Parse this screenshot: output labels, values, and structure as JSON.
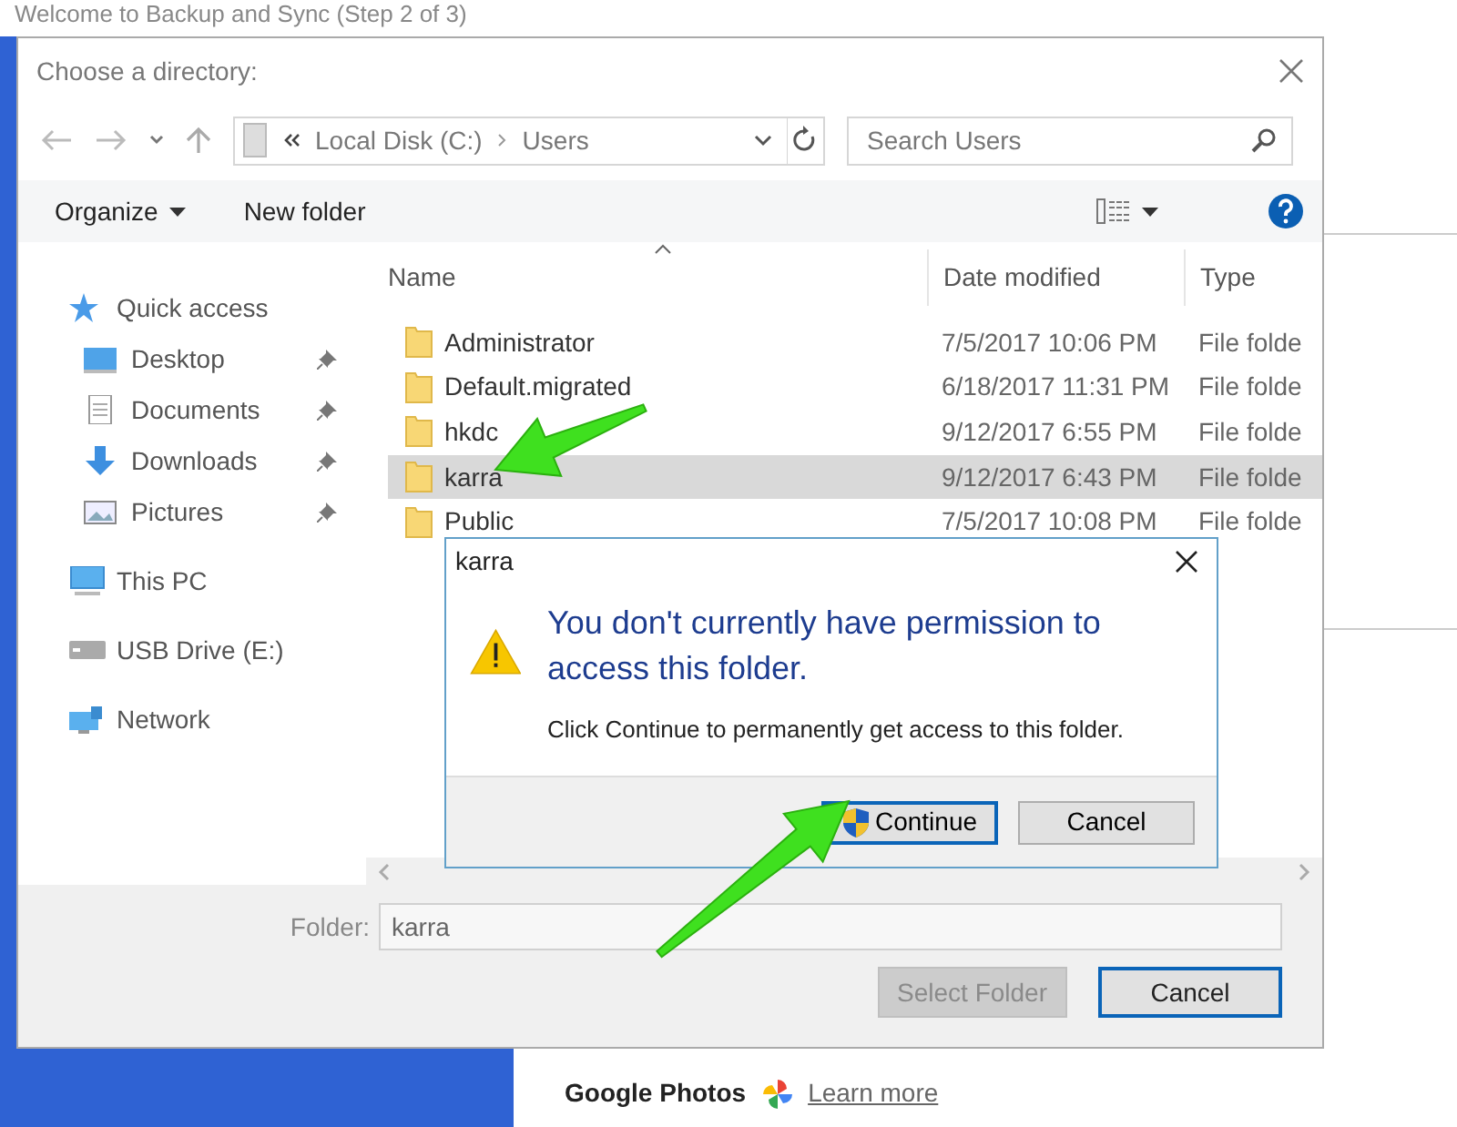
{
  "background_window": {
    "title": "Welcome to Backup and Sync (Step 2 of 3)",
    "product": "Google Photos",
    "link": "Learn more"
  },
  "dialog": {
    "title": "Choose a directory:",
    "address": [
      "Local Disk (C:)",
      "Users"
    ],
    "search": {
      "placeholder": "Search Users"
    },
    "toolbar": {
      "organize": "Organize",
      "new_folder": "New folder"
    },
    "nav": [
      {
        "label": "Quick access",
        "kind": "star",
        "pinned": false,
        "children": [
          {
            "label": "Desktop",
            "kind": "desktop",
            "pinned": true
          },
          {
            "label": "Documents",
            "kind": "documents",
            "pinned": true
          },
          {
            "label": "Downloads",
            "kind": "downloads",
            "pinned": true
          },
          {
            "label": "Pictures",
            "kind": "pictures",
            "pinned": true
          }
        ]
      },
      {
        "label": "This PC",
        "kind": "pc",
        "pinned": false
      },
      {
        "label": "USB Drive (E:)",
        "kind": "drive",
        "pinned": false
      },
      {
        "label": "Network",
        "kind": "network",
        "pinned": false
      }
    ],
    "columns": [
      "Name",
      "Date modified",
      "Type"
    ],
    "rows": [
      {
        "name": "Administrator",
        "date": "7/5/2017 10:06 PM",
        "type": "File folde",
        "selected": false
      },
      {
        "name": "Default.migrated",
        "date": "6/18/2017 11:31 PM",
        "type": "File folde",
        "selected": false
      },
      {
        "name": "hkdc",
        "date": "9/12/2017 6:55 PM",
        "type": "File folde",
        "selected": false
      },
      {
        "name": "karra",
        "date": "9/12/2017 6:43 PM",
        "type": "File folde",
        "selected": true
      },
      {
        "name": "Public",
        "date": "7/5/2017 10:08 PM",
        "type": "File folde",
        "selected": false
      }
    ],
    "folder_field": {
      "label": "Folder:",
      "value": "karra"
    },
    "buttons": [
      {
        "label": "Select Folder",
        "disabled": true,
        "focused": false
      },
      {
        "label": "Cancel",
        "disabled": false,
        "focused": true
      }
    ]
  },
  "permission_dialog": {
    "title": "karra",
    "heading": "You don't currently have permission to access this folder.",
    "message": "Click Continue to permanently get access to this folder.",
    "buttons": [
      {
        "label": "Continue",
        "shield": true,
        "focused": true
      },
      {
        "label": "Cancel",
        "shield": false,
        "focused": false
      }
    ]
  }
}
